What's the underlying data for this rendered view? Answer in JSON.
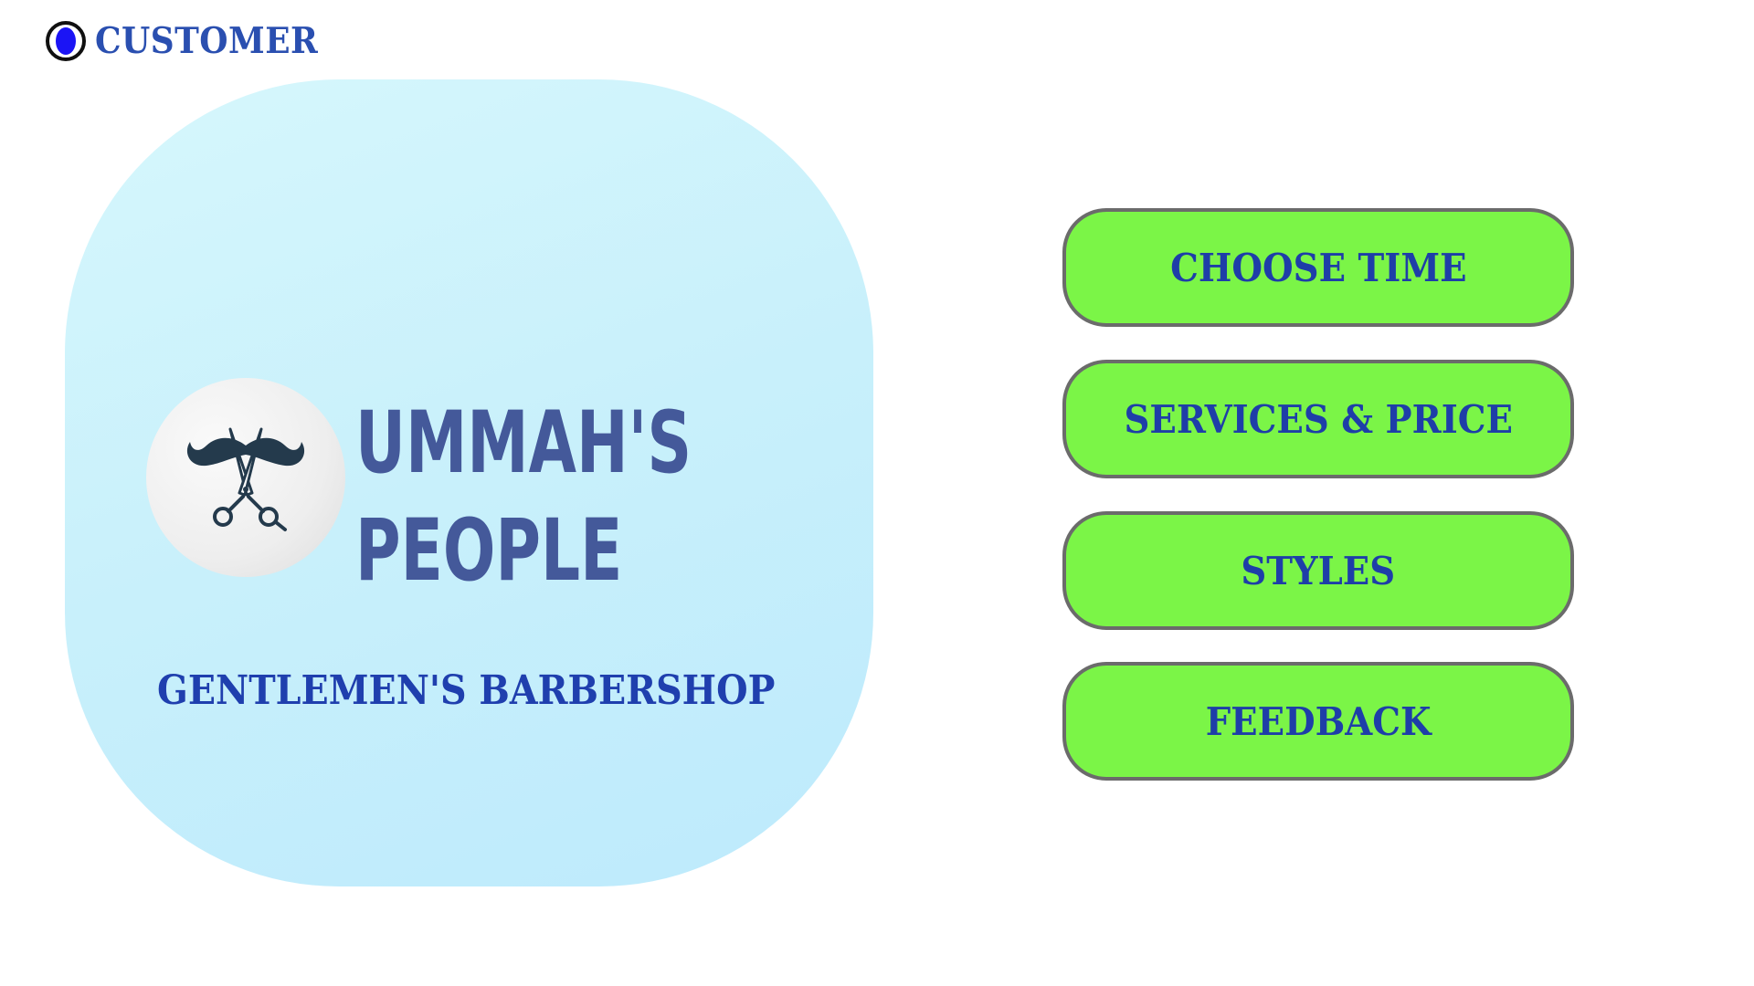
{
  "header": {
    "role_label": "CUSTOMER",
    "role_selected": true
  },
  "brand": {
    "name_line1": "UMMAH'S",
    "name_line2": "PEOPLE",
    "tagline": "GENTLEMEN'S BARBERSHOP",
    "logo_icon": "mustache-scissors-icon"
  },
  "menu": {
    "choose_time": "CHOOSE TIME",
    "services_price": "SERVICES & PRICE",
    "styles": "STYLES",
    "feedback": "FEEDBACK"
  },
  "colors": {
    "button_fill": "#7bf547",
    "button_text": "#1e3ea8",
    "card_background": "#c8f0fb",
    "brand_text": "#44599a",
    "radio_dot": "#1b14f5"
  }
}
